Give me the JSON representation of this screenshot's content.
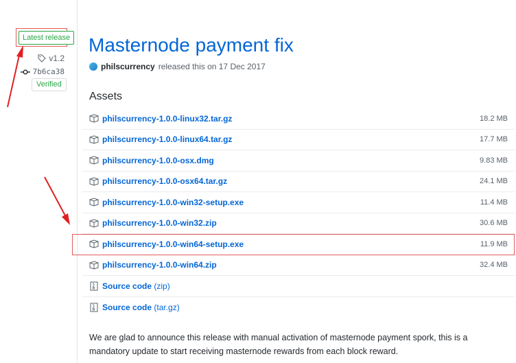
{
  "sidebar": {
    "latest_label": "Latest release",
    "tag": "v1.2",
    "commit": "7b6ca38",
    "verified_label": "Verified"
  },
  "release": {
    "title": "Masternode payment fix",
    "author": "philscurrency",
    "released_text": "released this on 17 Dec 2017"
  },
  "assets": {
    "heading": "Assets",
    "files": [
      {
        "name": "philscurrency-1.0.0-linux32.tar.gz",
        "size": "18.2 MB"
      },
      {
        "name": "philscurrency-1.0.0-linux64.tar.gz",
        "size": "17.7 MB"
      },
      {
        "name": "philscurrency-1.0.0-osx.dmg",
        "size": "9.83 MB"
      },
      {
        "name": "philscurrency-1.0.0-osx64.tar.gz",
        "size": "24.1 MB"
      },
      {
        "name": "philscurrency-1.0.0-win32-setup.exe",
        "size": "11.4 MB"
      },
      {
        "name": "philscurrency-1.0.0-win32.zip",
        "size": "30.6 MB"
      },
      {
        "name": "philscurrency-1.0.0-win64-setup.exe",
        "size": "11.9 MB"
      },
      {
        "name": "philscurrency-1.0.0-win64.zip",
        "size": "32.4 MB"
      }
    ],
    "source": [
      {
        "label": "Source code",
        "format": "(zip)"
      },
      {
        "label": "Source code",
        "format": "(tar.gz)"
      }
    ]
  },
  "description": "We are glad to announce this release with manual activation of masternode payment spork, this is a mandatory update to start receiving masternode rewards from each block reward.",
  "icons": {
    "tag": "tag-icon",
    "commit": "commit-icon",
    "package": "package-icon",
    "zip": "file-zip-icon"
  },
  "colors": {
    "link": "#0366d6",
    "green": "#28a745",
    "annotation_red": "#e02020"
  }
}
